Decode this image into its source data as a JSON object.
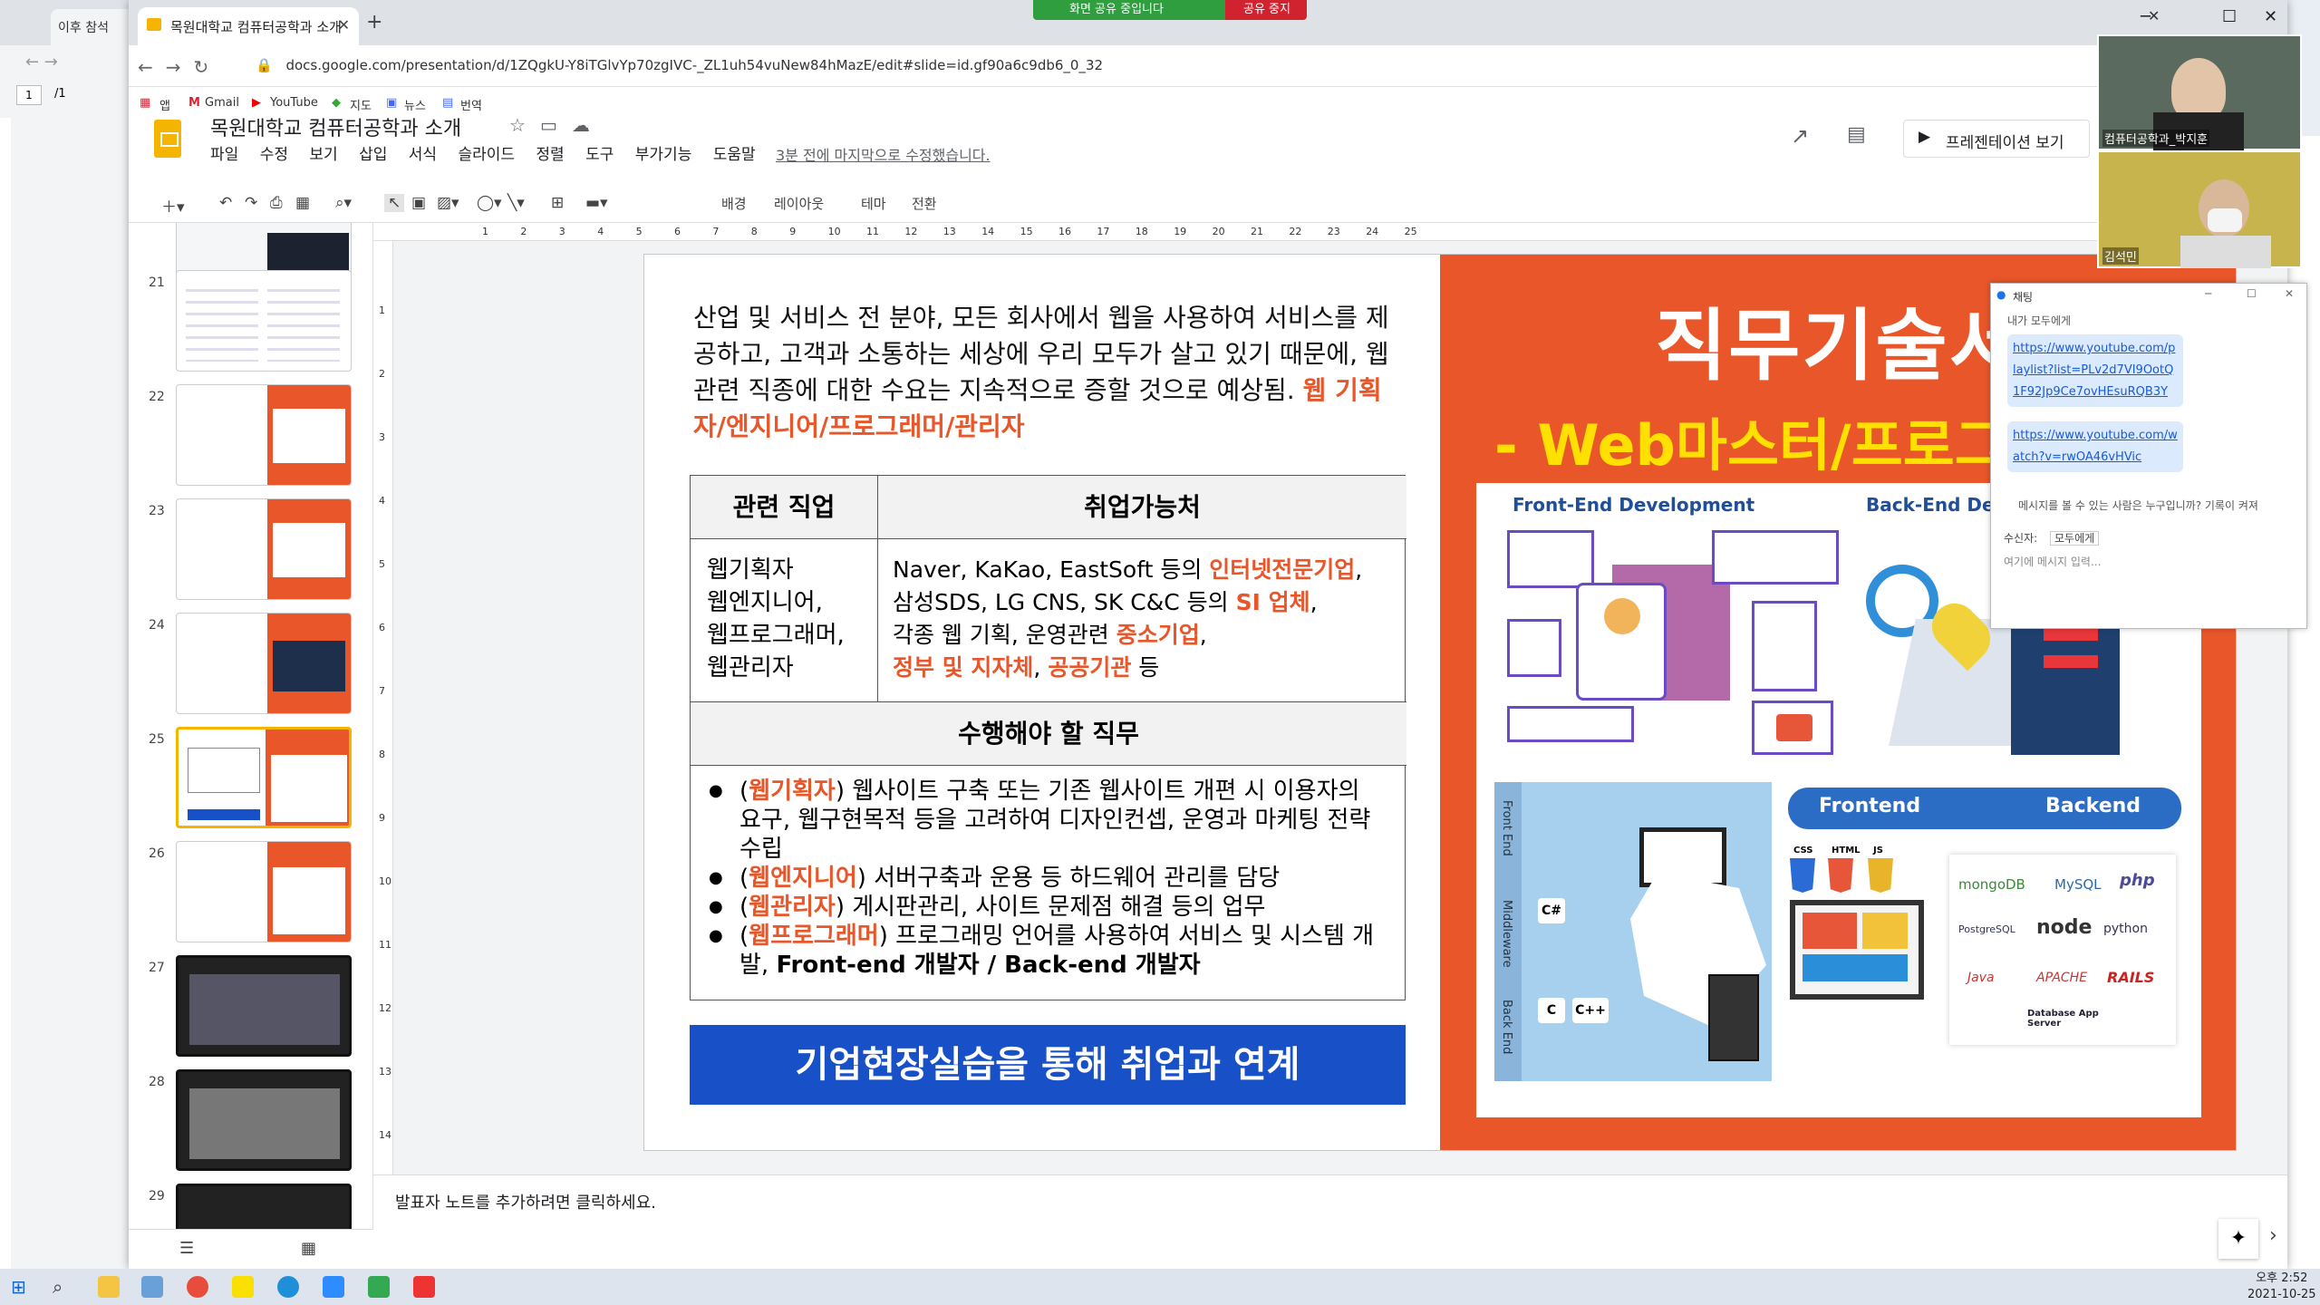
{
  "background": {
    "tab_label": "이후 참석",
    "pdf_page": "1",
    "pdf_of": "/1"
  },
  "browser": {
    "tab_title": "목원대학교 컴퓨터공학과 소개",
    "url": "docs.google.com/presentation/d/1ZQgkU-Y8iTGlvYp70zgIVC-_ZL1uh54vuNew84hMazE/edit#slide=id.gf90a6c9db6_0_32",
    "bookmarks": [
      "앱",
      "Gmail",
      "YouTube",
      "지도",
      "뉴스",
      "번역"
    ],
    "share_status": "화면 공유 중입니다",
    "share_stop": "공유 중지"
  },
  "docs": {
    "title": "목원대학교 컴퓨터공학과 소개",
    "menu": [
      "파일",
      "수정",
      "보기",
      "삽입",
      "서식",
      "슬라이드",
      "정렬",
      "도구",
      "부가기능",
      "도움말"
    ],
    "saved_status": "3분 전에 마지막으로 수정했습니다.",
    "present_label": "프레젠테이션 보기",
    "toolbar": {
      "background": "배경",
      "layout": "레이아웃",
      "theme": "테마",
      "transition": "전환"
    },
    "notes_placeholder": "발표자 노트를 추가하려면 클릭하세요."
  },
  "filmstrip": {
    "numbers": [
      "21",
      "22",
      "23",
      "24",
      "25",
      "26",
      "27",
      "28",
      "29"
    ],
    "active": "25"
  },
  "ruler": {
    "h_ticks": [
      "1",
      "2",
      "3",
      "4",
      "5",
      "6",
      "7",
      "8",
      "9",
      "10",
      "11",
      "12",
      "13",
      "14",
      "15",
      "16",
      "17",
      "18",
      "19",
      "20",
      "21",
      "22",
      "23",
      "24",
      "25"
    ],
    "v_ticks": [
      "1",
      "2",
      "3",
      "4",
      "5",
      "6",
      "7",
      "8",
      "9",
      "10",
      "11",
      "12",
      "13",
      "14"
    ]
  },
  "slide": {
    "intro": "산업 및 서비스 전 분야, 모든 회사에서 웹을 사용하여 서비스를 제공하고, 고객과 소통하는 세상에 우리 모두가 살고 있기 때문에, 웹관련 직종에 대한 수요는 지속적으로 증할 것으로 예상됨.",
    "intro_highlight": "웹 기획자/엔지니어/프로그래머/관리자",
    "table_header_job": "관련 직업",
    "table_header_emp": "취업가능처",
    "jobs": [
      "웹기획자",
      "웹엔지니어,",
      "웹프로그래머,",
      "웹관리자"
    ],
    "emp": {
      "l1a": "Naver, KaKao, EastSoft 등의 ",
      "l1b": "인터넷전문기업",
      "l1c": ",",
      "l2a": "삼성SDS, LG CNS, SK C&C 등의 ",
      "l2b": "SI 업체",
      "l2c": ",",
      "l3a": "각종 웹 기획, 운영관련 ",
      "l3b": "중소기업",
      "l3c": ",",
      "l4a": "정부 및 지자체",
      "l4b": ", ",
      "l4c": "공공기관",
      "l4d": " 등"
    },
    "tasks_header": "수행해야 할 직무",
    "tasks": [
      {
        "open": "(",
        "role": "웹기획자",
        "text": ") 웹사이트 구축 또는 기존 웹사이트 개편 시 이용자의 요구, 웹구현목적 등을 고려하여 디자인컨셉, 운영과 마케팅 전략 수립"
      },
      {
        "open": "(",
        "role": "웹엔지니어",
        "text": ") 서버구축과 운용 등 하드웨어 관리를 담당"
      },
      {
        "open": "(",
        "role": "웹관리자",
        "text": ") 게시판관리, 사이트 문제점 해결 등의 업무"
      },
      {
        "open": "(",
        "role": "웹프로그래머",
        "text": ") 프로그래밍 언어를 사용하여 서비스 및 시스템 개발, ",
        "bold": "Front-end 개발자 / Back-end 개발자"
      }
    ],
    "banner": "기업현장실습을 통해 취업과 연계",
    "right_title": "직무기술서",
    "right_subtitle": "-  Web마스터/프로그래머",
    "img_frontend_dev": "Front-End Development",
    "img_backend_dev": "Back-End Development",
    "img_frontend": "Frontend",
    "img_backend": "Backend",
    "img_side_labels": [
      "Front End",
      "Middleware",
      "Back End"
    ],
    "img_tech": [
      "CSS",
      "HTML",
      "JS",
      "C#",
      "C",
      "C++",
      "mongoDB",
      "MySQL",
      "php",
      "PostgreSQL",
      "node",
      "python",
      "Java",
      "APACHE",
      "RAILS",
      "Database App Server"
    ]
  },
  "video": {
    "top_label": "컴퓨터공학과_박지훈",
    "bottom_label": "김석민"
  },
  "chat": {
    "title": "채팅",
    "to": "내가 모두에게",
    "link1": "https://www.youtube.com/playlist?list=PLv2d7VI9OotQ1F92Jp9Ce7ovHEsuRQB3Y",
    "link2": "https://www.youtube.com/watch?v=rwOA46vHVic",
    "notice": "메시지를 볼 수 있는 사람은 누구입니까? 기록이 켜져",
    "receiver_label": "수신자:",
    "receiver_value": "모두에게",
    "input_placeholder": "여기에 메시지 입력..."
  },
  "taskbar": {
    "time": "오후 2:52",
    "date": "2021-10-25"
  }
}
